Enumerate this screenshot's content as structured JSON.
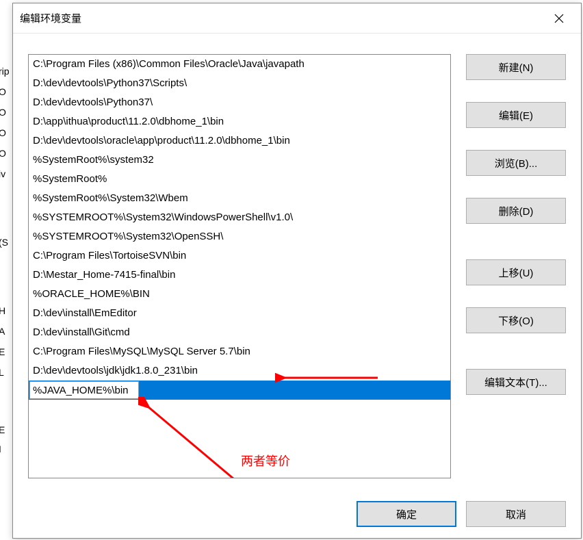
{
  "dialog": {
    "title": "编辑环境变量"
  },
  "path_entries": [
    "C:\\Program Files (x86)\\Common Files\\Oracle\\Java\\javapath",
    "D:\\dev\\devtools\\Python37\\Scripts\\",
    "D:\\dev\\devtools\\Python37\\",
    "D:\\app\\ithua\\product\\11.2.0\\dbhome_1\\bin",
    "D:\\dev\\devtools\\oracle\\app\\product\\11.2.0\\dbhome_1\\bin",
    "%SystemRoot%\\system32",
    "%SystemRoot%",
    "%SystemRoot%\\System32\\Wbem",
    "%SYSTEMROOT%\\System32\\WindowsPowerShell\\v1.0\\",
    "%SYSTEMROOT%\\System32\\OpenSSH\\",
    "C:\\Program Files\\TortoiseSVN\\bin",
    "D:\\Mestar_Home-7415-final\\bin",
    "%ORACLE_HOME%\\BIN",
    "D:\\dev\\install\\EmEditor",
    "D:\\dev\\install\\Git\\cmd",
    "C:\\Program Files\\MySQL\\MySQL Server 5.7\\bin",
    "D:\\dev\\devtools\\jdk\\jdk1.8.0_231\\bin"
  ],
  "editing_value": "%JAVA_HOME%\\bin",
  "buttons": {
    "new": "新建(N)",
    "edit": "编辑(E)",
    "browse": "浏览(B)...",
    "delete": "删除(D)",
    "move_up": "上移(U)",
    "move_down": "下移(O)",
    "edit_text": "编辑文本(T)...",
    "ok": "确定",
    "cancel": "取消"
  },
  "annotation": {
    "label": "两者等价"
  },
  "background_fragments": [
    "rip",
    "O",
    "O",
    "O",
    "O",
    "iv",
    "(S",
    "H",
    "A",
    "E",
    "L",
    "E",
    "I"
  ]
}
